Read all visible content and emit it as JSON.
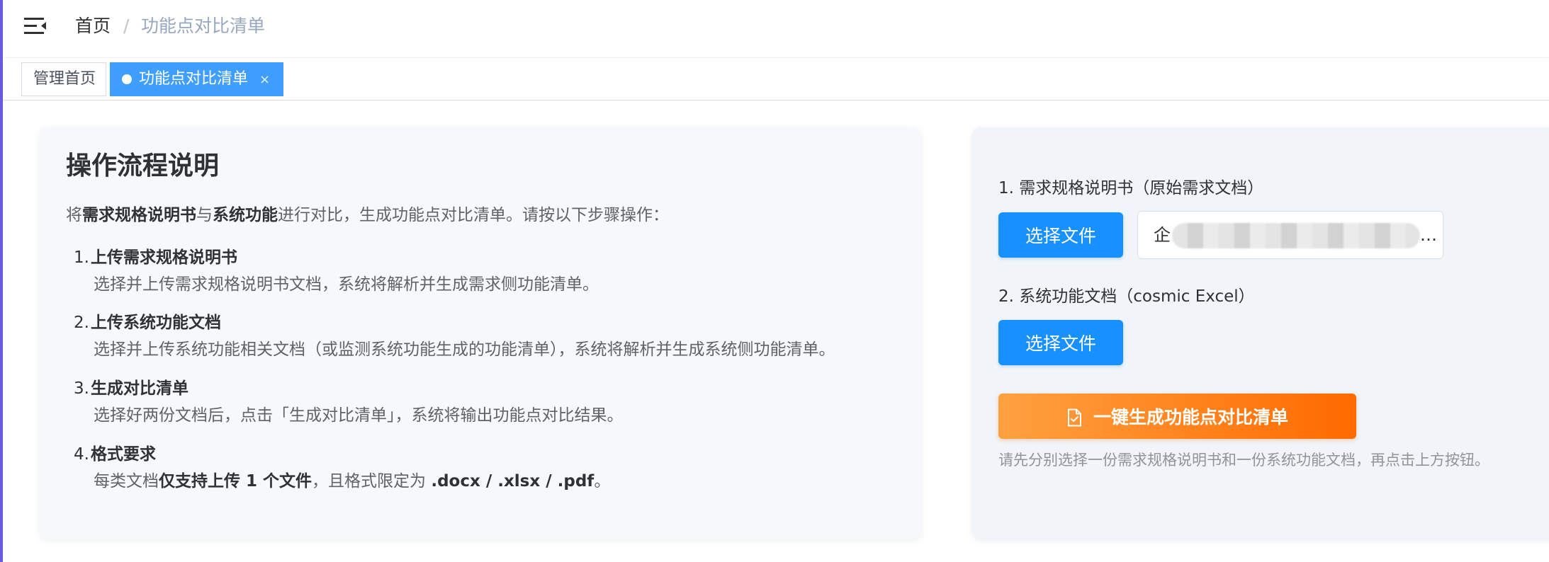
{
  "header": {
    "breadcrumb_home": "首页",
    "breadcrumb_separator": "/",
    "breadcrumb_current": "功能点对比清单"
  },
  "tags": {
    "home": "管理首页",
    "active": "功能点对比清单",
    "close_glyph": "×"
  },
  "left": {
    "title": "操作流程说明",
    "intro_prefix": "将",
    "intro_bold1": "需求规格说明书",
    "intro_mid": "与",
    "intro_bold2": "系统功能",
    "intro_suffix": "进行对比，生成功能点对比清单。请按以下步骤操作：",
    "steps": [
      {
        "num": "1.",
        "title": "上传需求规格说明书",
        "desc": "选择并上传需求规格说明书文档，系统将解析并生成需求侧功能清单。"
      },
      {
        "num": "2.",
        "title": "上传系统功能文档",
        "desc": "选择并上传系统功能相关文档（或监测系统功能生成的功能清单），系统将解析并生成系统侧功能清单。"
      },
      {
        "num": "3.",
        "title": "生成对比清单",
        "desc": "选择好两份文档后，点击「生成对比清单」，系统将输出功能点对比结果。"
      },
      {
        "num": "4.",
        "title": "格式要求",
        "desc_prefix": "每类文档",
        "desc_bold": "仅支持上传 1 个文件",
        "desc_mid": "，且格式限定为 ",
        "desc_formats": ".docx / .xlsx / .pdf",
        "desc_suffix": "。"
      }
    ]
  },
  "right": {
    "label_spec": "1. 需求规格说明书（原始需求文档）",
    "choose_file": "选择文件",
    "spec_file_prefix": "企",
    "spec_file_ellipsis": "…",
    "label_sys": "2. 系统功能文档（cosmic Excel）",
    "generate_label": "一键生成功能点对比清单",
    "hint": "请先分别选择一份需求规格说明书和一份系统功能文档，再点击上方按钮。"
  },
  "colors": {
    "primary": "#1890ff",
    "tag_active": "#409eff",
    "generate_start": "#ffa140",
    "generate_end": "#ff6a00"
  },
  "icons": {
    "hamburger": "menu-fold-icon",
    "generate": "document-check-icon"
  }
}
